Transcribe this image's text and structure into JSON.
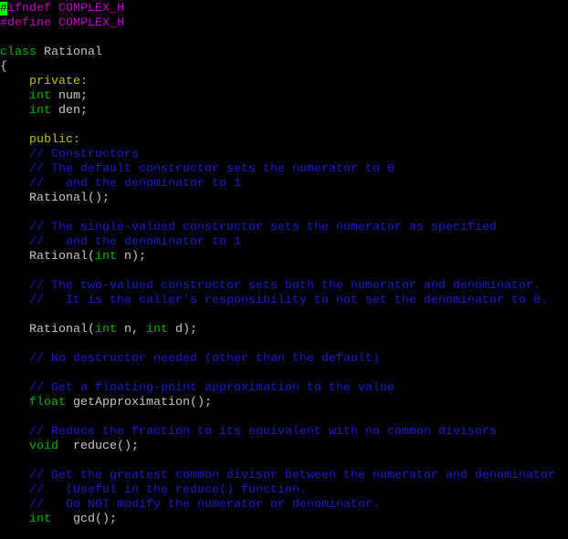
{
  "colors": {
    "preprocessor": "#c000c0",
    "keyword": "#00b000",
    "label": "#c0c000",
    "comment": "#1c1cc8",
    "text": "#c8c8c8",
    "cursor": "#00ff00",
    "background": "#000000"
  },
  "editor": {
    "lines": [
      [
        {
          "t": "#",
          "c": "pre cursor"
        },
        {
          "t": "ifndef COMPLEX_H",
          "c": "pre"
        }
      ],
      [
        {
          "t": "#define COMPLEX_H",
          "c": "pre"
        }
      ],
      [],
      [
        {
          "t": "class",
          "c": "kw"
        },
        {
          "t": " Rational",
          "c": "txt"
        }
      ],
      [
        {
          "t": "{",
          "c": "txt"
        }
      ],
      [
        {
          "t": "    ",
          "c": "txt"
        },
        {
          "t": "private:",
          "c": "lbl"
        }
      ],
      [
        {
          "t": "    ",
          "c": "txt"
        },
        {
          "t": "int",
          "c": "kw"
        },
        {
          "t": " num;",
          "c": "txt"
        }
      ],
      [
        {
          "t": "    ",
          "c": "txt"
        },
        {
          "t": "int",
          "c": "kw"
        },
        {
          "t": " den;",
          "c": "txt"
        }
      ],
      [],
      [
        {
          "t": "    ",
          "c": "txt"
        },
        {
          "t": "public:",
          "c": "lbl"
        }
      ],
      [
        {
          "t": "    ",
          "c": "txt"
        },
        {
          "t": "// Constructors",
          "c": "cmt"
        }
      ],
      [
        {
          "t": "    ",
          "c": "txt"
        },
        {
          "t": "// The default constructor sets the numerator to 0",
          "c": "cmt"
        }
      ],
      [
        {
          "t": "    ",
          "c": "txt"
        },
        {
          "t": "//   and the denominator to 1",
          "c": "cmt"
        }
      ],
      [
        {
          "t": "    Rational();",
          "c": "txt"
        }
      ],
      [],
      [
        {
          "t": "    ",
          "c": "txt"
        },
        {
          "t": "// The single-valued constructor sets the numerator as specified",
          "c": "cmt"
        }
      ],
      [
        {
          "t": "    ",
          "c": "txt"
        },
        {
          "t": "//   and the denominator to 1",
          "c": "cmt"
        }
      ],
      [
        {
          "t": "    Rational(",
          "c": "txt"
        },
        {
          "t": "int",
          "c": "kw"
        },
        {
          "t": " n);",
          "c": "txt"
        }
      ],
      [],
      [
        {
          "t": "    ",
          "c": "txt"
        },
        {
          "t": "// The two-valued constructor sets both the numerator and denominator.",
          "c": "cmt"
        }
      ],
      [
        {
          "t": "    ",
          "c": "txt"
        },
        {
          "t": "//   It is the caller's responsibility to not set the denominator to 0.",
          "c": "cmt"
        }
      ],
      [],
      [
        {
          "t": "    Rational(",
          "c": "txt"
        },
        {
          "t": "int",
          "c": "kw"
        },
        {
          "t": " n, ",
          "c": "txt"
        },
        {
          "t": "int",
          "c": "kw"
        },
        {
          "t": " d);",
          "c": "txt"
        }
      ],
      [],
      [
        {
          "t": "    ",
          "c": "txt"
        },
        {
          "t": "// No destructor needed (other than the default)",
          "c": "cmt"
        }
      ],
      [],
      [
        {
          "t": "    ",
          "c": "txt"
        },
        {
          "t": "// Get a floating-point approximation to the value",
          "c": "cmt"
        }
      ],
      [
        {
          "t": "    ",
          "c": "txt"
        },
        {
          "t": "float",
          "c": "kw"
        },
        {
          "t": " getApproximation();",
          "c": "txt"
        }
      ],
      [],
      [
        {
          "t": "    ",
          "c": "txt"
        },
        {
          "t": "// Reduce the fraction to its equivalent with no common divisors",
          "c": "cmt"
        }
      ],
      [
        {
          "t": "    ",
          "c": "txt"
        },
        {
          "t": "void",
          "c": "kw"
        },
        {
          "t": "  reduce();",
          "c": "txt"
        }
      ],
      [],
      [
        {
          "t": "    ",
          "c": "txt"
        },
        {
          "t": "// Get the greatest common divisor between the numerator and denominator",
          "c": "cmt"
        }
      ],
      [
        {
          "t": "    ",
          "c": "txt"
        },
        {
          "t": "//   (Useful in the reduce() function.",
          "c": "cmt"
        }
      ],
      [
        {
          "t": "    ",
          "c": "txt"
        },
        {
          "t": "//   Do NOT modify the numerator or denominator.",
          "c": "cmt"
        }
      ],
      [
        {
          "t": "    ",
          "c": "txt"
        },
        {
          "t": "int",
          "c": "kw"
        },
        {
          "t": "   gcd();",
          "c": "txt"
        }
      ]
    ]
  }
}
